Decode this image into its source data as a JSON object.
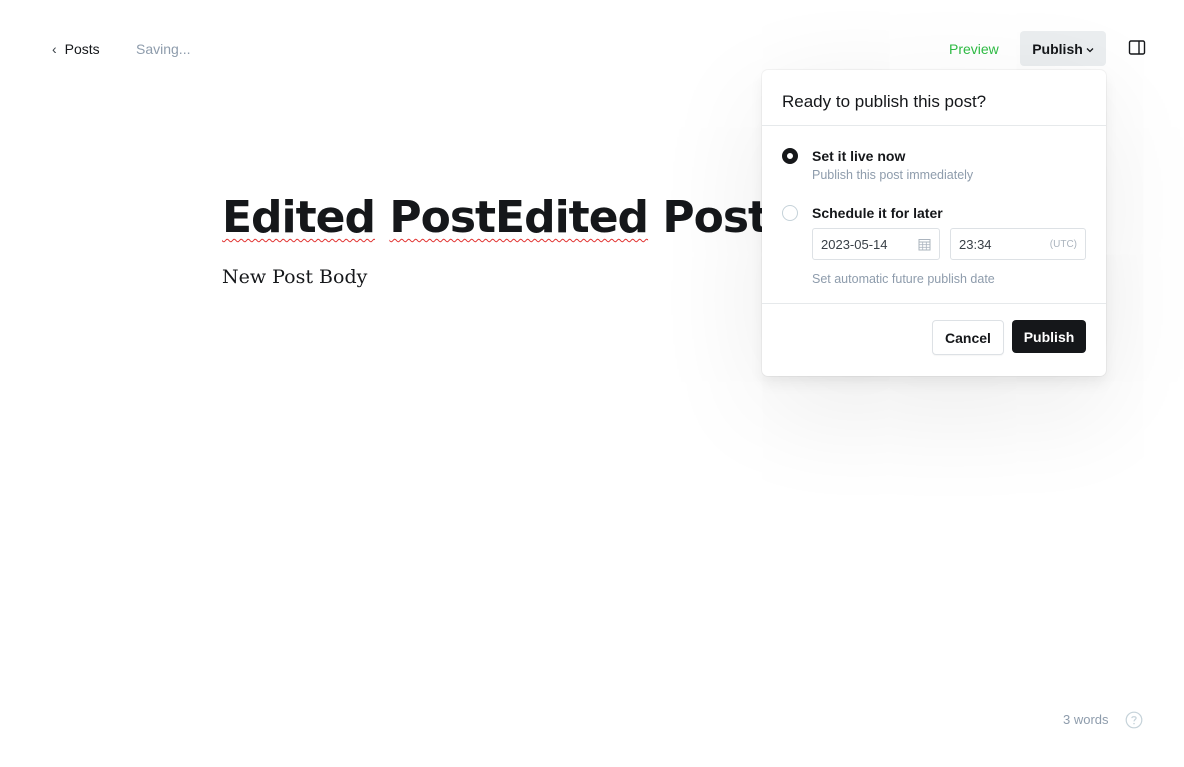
{
  "header": {
    "back_label": "Posts",
    "status": "Saving...",
    "preview_label": "Preview",
    "publish_label": "Publish"
  },
  "editor": {
    "title_part1": "Edited",
    "title_part2": "PostEdited",
    "title_part3": "Post Body",
    "body": "New Post Body"
  },
  "publish_menu": {
    "heading": "Ready to publish this post?",
    "options": [
      {
        "title": "Set it live now",
        "subtitle": "Publish this post immediately",
        "selected": true
      },
      {
        "title": "Schedule it for later",
        "selected": false
      }
    ],
    "date_value": "2023-05-14",
    "time_value": "23:34",
    "timezone": "(UTC)",
    "schedule_hint": "Set automatic future publish date",
    "cancel_label": "Cancel",
    "confirm_label": "Publish"
  },
  "footer": {
    "word_count": "3 words"
  },
  "colors": {
    "accent_green": "#2ebc44",
    "dark": "#15171a",
    "muted": "#8e9cac"
  }
}
